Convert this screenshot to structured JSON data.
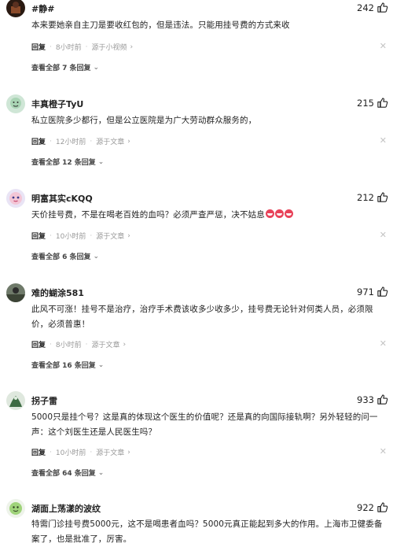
{
  "comments": [
    {
      "user": "#静#",
      "likes": "242",
      "text": "本来要她亲自主刀是要收红包的，但是违法。只能用挂号费的方式来收",
      "reply_label": "回复",
      "time": "8小时前",
      "source": "源于小视频",
      "view_replies": "查看全部 7 条回复"
    },
    {
      "user": "丰真橙子TyU",
      "likes": "215",
      "text": "私立医院多少都行，但是公立医院是为广大劳动群众服务的，",
      "reply_label": "回复",
      "time": "12小时前",
      "source": "源于文章",
      "view_replies": "查看全部 12 条回复"
    },
    {
      "user": "明富其实cKQQ",
      "likes": "212",
      "text": "天价挂号费，不是在喝老百姓的血吗？必须严查严惩，决不姑息",
      "reply_label": "回复",
      "time": "10小时前",
      "source": "源于文章",
      "view_replies": "查看全部 6 条回复"
    },
    {
      "user": "难的蝴涂581",
      "likes": "971",
      "text": "此风不可涨！挂号不是治疗，治疗手术费该收多少收多少，挂号费无论针对何类人员，必须限价，必须普惠！",
      "reply_label": "回复",
      "time": "8小时前",
      "source": "源于文章",
      "view_replies": "查看全部 16 条回复"
    },
    {
      "user": "拐子雷",
      "likes": "933",
      "text": "5000只是挂个号？这是真的体现这个医生的价值呢？还是真的向国际接轨啊？另外轻轻的问一声：这个刘医生还是人民医生吗？",
      "reply_label": "回复",
      "time": "10小时前",
      "source": "源于文章",
      "view_replies": "查看全部 64 条回复"
    },
    {
      "user": "湖面上荡漾的波纹",
      "likes": "922",
      "text": "特需门诊挂号费5000元，这不是喝患者血吗？5000元真正能起到多大的作用。上海市卫健委备案了，也是批准了，厉害。"
    }
  ],
  "icons": {
    "like": "thumbs-up-icon",
    "close": "close-icon",
    "chevron": "chevron-right-icon",
    "emoji": "angry-face-emoji"
  },
  "colors": {
    "text": "#222222",
    "meta": "#999999",
    "divider_close": "#c4c4c4"
  }
}
